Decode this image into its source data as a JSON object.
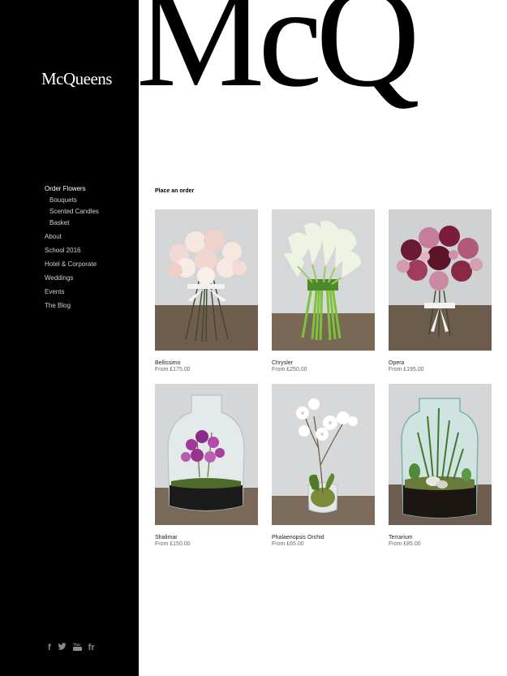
{
  "brand": {
    "logo_text": "McQueens",
    "banner_text": "McQ"
  },
  "sidebar": {
    "items": [
      {
        "label": "Order Flowers",
        "active": true
      },
      {
        "label": "Bouquets",
        "sub": true
      },
      {
        "label": "Scented Candles",
        "sub": true
      },
      {
        "label": "Basket",
        "sub": true
      },
      {
        "label": "About"
      },
      {
        "label": "School 2016"
      },
      {
        "label": "Hotel & Corporate"
      },
      {
        "label": "Weddings"
      },
      {
        "label": "Events"
      },
      {
        "label": "The Blog"
      }
    ],
    "social": [
      {
        "icon": "facebook-icon",
        "glyph": "f"
      },
      {
        "icon": "twitter-icon",
        "glyph": "t"
      },
      {
        "icon": "youtube-icon",
        "glyph": "▶"
      },
      {
        "icon": "flickr-icon",
        "glyph": "fr"
      }
    ]
  },
  "main": {
    "title": "Place an order",
    "products": [
      {
        "name": "Bellissimo",
        "price": "From £175.00"
      },
      {
        "name": "Chrysler",
        "price": "From £250.00"
      },
      {
        "name": "Opera",
        "price": "From £195.00"
      },
      {
        "name": "Shalimar",
        "price": "From £150.00"
      },
      {
        "name": "Phalaenopsis Orchid",
        "price": "From £65.00"
      },
      {
        "name": "Terrarium",
        "price": "From £85.00"
      }
    ]
  },
  "colors": {
    "sidebar_bg": "#000000",
    "page_bg": "#ffffff",
    "wall": "#d9dadb",
    "table": "#6e5a4a"
  }
}
